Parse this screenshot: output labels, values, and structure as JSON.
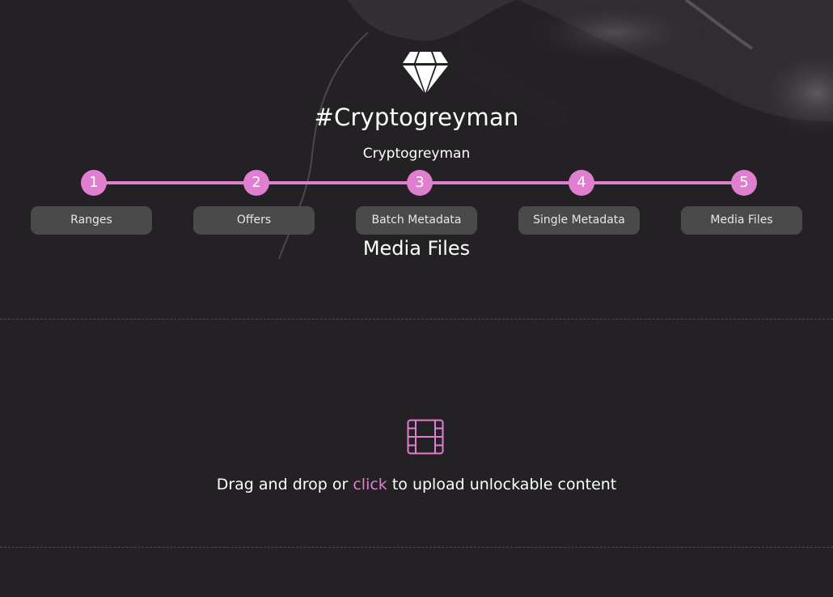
{
  "brand": {
    "logo_icon": "diamond-icon",
    "accent_color": "#e07fd0",
    "background_color": "#232123"
  },
  "collection": {
    "title": "#Cryptogreyman",
    "subtitle": "Cryptogreyman"
  },
  "steps": [
    {
      "number": "1",
      "label": "Ranges"
    },
    {
      "number": "2",
      "label": "Offers"
    },
    {
      "number": "3",
      "label": "Batch Metadata"
    },
    {
      "number": "4",
      "label": "Single Metadata"
    },
    {
      "number": "5",
      "label": "Media Files"
    }
  ],
  "section": {
    "heading": "Media Files"
  },
  "dropzone": {
    "icon": "film-icon",
    "text_before": "Drag and drop or ",
    "link_text": "click",
    "text_after": " to upload unlockable content"
  }
}
